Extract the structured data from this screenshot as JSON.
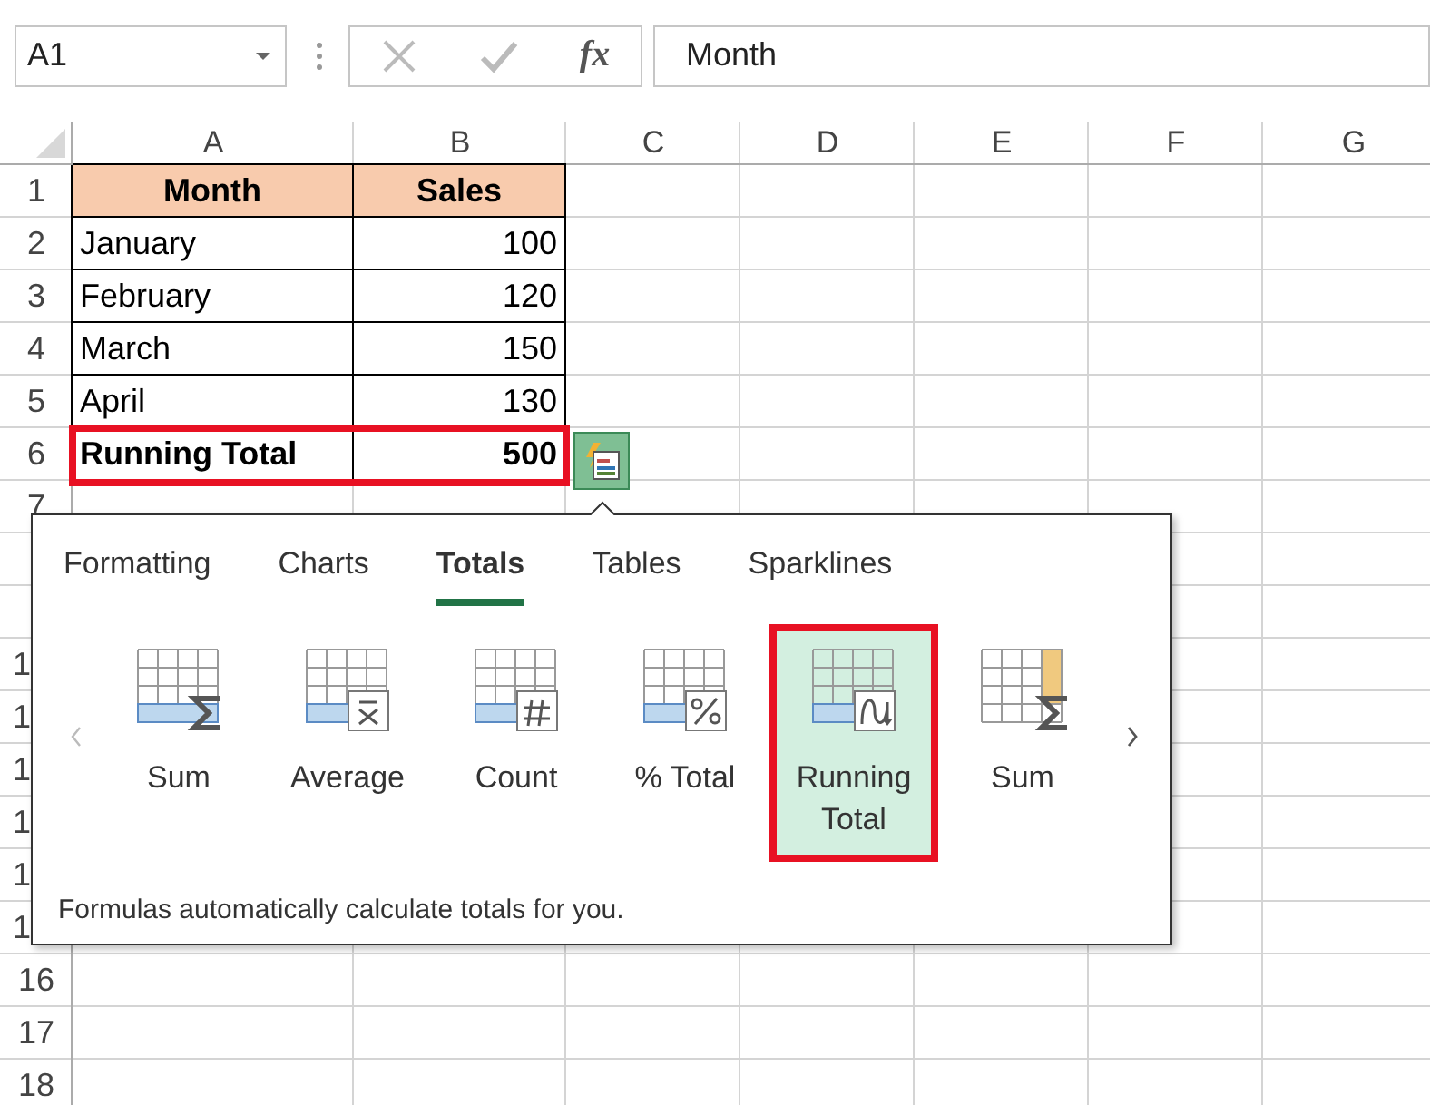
{
  "name_box": {
    "value": "A1"
  },
  "formula_bar": {
    "function_label": "fx",
    "value": "Month"
  },
  "columns": [
    "A",
    "B",
    "C",
    "D",
    "E",
    "F",
    "G"
  ],
  "rows": [
    {
      "number": "1",
      "kind": "header",
      "cells": [
        "Month",
        "Sales"
      ]
    },
    {
      "number": "2",
      "kind": "data",
      "cells": [
        "January",
        "100"
      ]
    },
    {
      "number": "3",
      "kind": "data",
      "cells": [
        "February",
        "120"
      ]
    },
    {
      "number": "4",
      "kind": "data",
      "cells": [
        "March",
        "150"
      ]
    },
    {
      "number": "5",
      "kind": "data",
      "cells": [
        "April",
        "130"
      ]
    },
    {
      "number": "6",
      "kind": "total",
      "cells": [
        "Running Total",
        "500"
      ],
      "highlighted": true
    },
    {
      "number": "7"
    },
    {},
    {},
    {
      "number": "1",
      "number_cut": true
    },
    {
      "number": "1",
      "number_cut": true
    },
    {
      "number": "1",
      "number_cut": true
    },
    {
      "number": "1",
      "number_cut": true
    },
    {
      "number": "1",
      "number_cut": true
    },
    {
      "number": "1",
      "number_cut": true
    },
    {
      "number": "16"
    },
    {
      "number": "17"
    },
    {
      "number": "18"
    }
  ],
  "quick_analysis": {
    "tabs": [
      {
        "label": "Formatting",
        "selected": false
      },
      {
        "label": "Charts",
        "selected": false
      },
      {
        "label": "Totals",
        "selected": true
      },
      {
        "label": "Tables",
        "selected": false
      },
      {
        "label": "Sparklines",
        "selected": false
      }
    ],
    "options": [
      {
        "label": "Sum",
        "kind": "sum",
        "selected": false,
        "highlighted": false
      },
      {
        "label": "Average",
        "kind": "average",
        "selected": false,
        "highlighted": false
      },
      {
        "label": "Count",
        "kind": "count",
        "selected": false,
        "highlighted": false
      },
      {
        "label": "% Total",
        "kind": "percent",
        "selected": false,
        "highlighted": false
      },
      {
        "label": "Running Total",
        "kind": "running",
        "selected": true,
        "highlighted": true
      },
      {
        "label": "Sum",
        "kind": "column-sum",
        "selected": false,
        "highlighted": false
      }
    ],
    "description": "Formulas automatically calculate totals for you."
  }
}
